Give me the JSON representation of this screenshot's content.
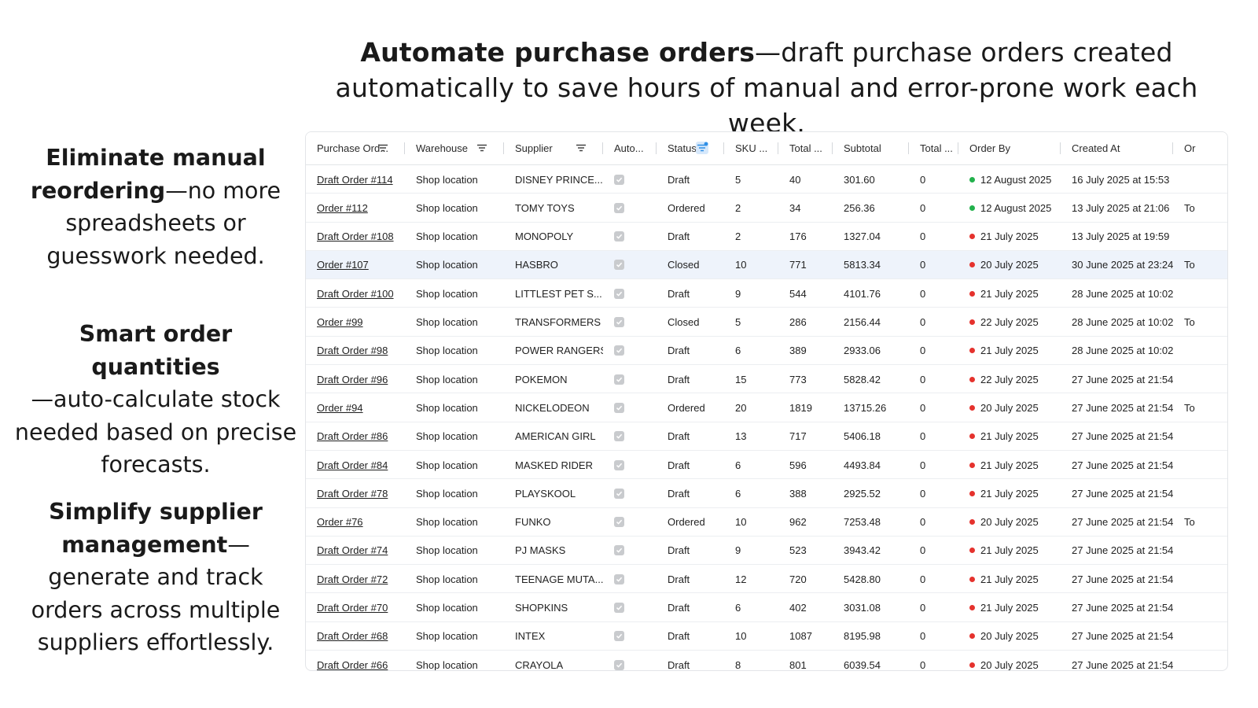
{
  "headline": {
    "bold": "Automate purchase orders",
    "rest": "—draft purchase orders created automatically to save hours of manual and error-prone work each week."
  },
  "features": [
    {
      "bold": "Eliminate manual reordering",
      "rest": "—no more spreadsheets or guesswork needed."
    },
    {
      "bold": "Smart order quantities",
      "rest": "—auto-calculate stock needed based on precise forecasts."
    },
    {
      "bold": "Simplify supplier management",
      "rest": "—generate and track orders across multiple suppliers effortlessly."
    }
  ],
  "table": {
    "columns": [
      {
        "label": "Purchase Ord...",
        "filter": true,
        "active": false
      },
      {
        "label": "Warehouse",
        "filter": true,
        "active": false
      },
      {
        "label": "Supplier",
        "filter": true,
        "active": false
      },
      {
        "label": "Auto...",
        "filter": false,
        "active": false
      },
      {
        "label": "Status",
        "filter": true,
        "active": true
      },
      {
        "label": "SKU ...",
        "filter": false,
        "active": false
      },
      {
        "label": "Total ...",
        "filter": false,
        "active": false
      },
      {
        "label": "Subtotal",
        "filter": false,
        "active": false
      },
      {
        "label": "Total ...",
        "filter": false,
        "active": false
      },
      {
        "label": "Order By",
        "filter": false,
        "active": false
      },
      {
        "label": "Created At",
        "filter": false,
        "active": false
      },
      {
        "label": "Or",
        "filter": false,
        "active": false
      }
    ],
    "status_colors": {
      "green": "#22b14c",
      "red": "#e5322d",
      "highlight_row": "#eef3fb",
      "filter_active_bg": "#d6e8fb",
      "filter_active_dot": "#2f8fe6"
    },
    "rows": [
      {
        "order": "Draft Order #114",
        "warehouse": "Shop location",
        "supplier": "DISNEY PRINCE...",
        "auto": true,
        "status": "Draft",
        "sku": "5",
        "total_qty": "40",
        "subtotal": "301.60",
        "total": "0",
        "order_by": "12 August 2025",
        "dot": "green",
        "created": "16 July 2025 at 15:53",
        "extra": ""
      },
      {
        "order": "Order #112",
        "warehouse": "Shop location",
        "supplier": "TOMY TOYS",
        "auto": true,
        "status": "Ordered",
        "sku": "2",
        "total_qty": "34",
        "subtotal": "256.36",
        "total": "0",
        "order_by": "12 August 2025",
        "dot": "green",
        "created": "13 July 2025 at 21:06",
        "extra": "To"
      },
      {
        "order": "Draft Order #108",
        "warehouse": "Shop location",
        "supplier": "MONOPOLY",
        "auto": true,
        "status": "Draft",
        "sku": "2",
        "total_qty": "176",
        "subtotal": "1327.04",
        "total": "0",
        "order_by": "21 July 2025",
        "dot": "red",
        "created": "13 July 2025 at 19:59",
        "extra": ""
      },
      {
        "order": "Order #107",
        "warehouse": "Shop location",
        "supplier": "HASBRO",
        "auto": true,
        "status": "Closed",
        "sku": "10",
        "total_qty": "771",
        "subtotal": "5813.34",
        "total": "0",
        "order_by": "20 July 2025",
        "dot": "red",
        "created": "30 June 2025 at 23:24",
        "extra": "To",
        "highlight": true
      },
      {
        "order": "Draft Order #100",
        "warehouse": "Shop location",
        "supplier": "LITTLEST PET S...",
        "auto": true,
        "status": "Draft",
        "sku": "9",
        "total_qty": "544",
        "subtotal": "4101.76",
        "total": "0",
        "order_by": "21 July 2025",
        "dot": "red",
        "created": "28 June 2025 at 10:02",
        "extra": ""
      },
      {
        "order": "Order #99",
        "warehouse": "Shop location",
        "supplier": "TRANSFORMERS",
        "auto": true,
        "status": "Closed",
        "sku": "5",
        "total_qty": "286",
        "subtotal": "2156.44",
        "total": "0",
        "order_by": "22 July 2025",
        "dot": "red",
        "created": "28 June 2025 at 10:02",
        "extra": "To"
      },
      {
        "order": "Draft Order #98",
        "warehouse": "Shop location",
        "supplier": "POWER RANGERS",
        "auto": true,
        "status": "Draft",
        "sku": "6",
        "total_qty": "389",
        "subtotal": "2933.06",
        "total": "0",
        "order_by": "21 July 2025",
        "dot": "red",
        "created": "28 June 2025 at 10:02",
        "extra": ""
      },
      {
        "order": "Draft Order #96",
        "warehouse": "Shop location",
        "supplier": "POKEMON",
        "auto": true,
        "status": "Draft",
        "sku": "15",
        "total_qty": "773",
        "subtotal": "5828.42",
        "total": "0",
        "order_by": "22 July 2025",
        "dot": "red",
        "created": "27 June 2025 at 21:54",
        "extra": ""
      },
      {
        "order": "Order #94",
        "warehouse": "Shop location",
        "supplier": "NICKELODEON",
        "auto": true,
        "status": "Ordered",
        "sku": "20",
        "total_qty": "1819",
        "subtotal": "13715.26",
        "total": "0",
        "order_by": "20 July 2025",
        "dot": "red",
        "created": "27 June 2025 at 21:54",
        "extra": "To"
      },
      {
        "order": "Draft Order #86",
        "warehouse": "Shop location",
        "supplier": "AMERICAN GIRL",
        "auto": true,
        "status": "Draft",
        "sku": "13",
        "total_qty": "717",
        "subtotal": "5406.18",
        "total": "0",
        "order_by": "21 July 2025",
        "dot": "red",
        "created": "27 June 2025 at 21:54",
        "extra": ""
      },
      {
        "order": "Draft Order #84",
        "warehouse": "Shop location",
        "supplier": "MASKED RIDER",
        "auto": true,
        "status": "Draft",
        "sku": "6",
        "total_qty": "596",
        "subtotal": "4493.84",
        "total": "0",
        "order_by": "21 July 2025",
        "dot": "red",
        "created": "27 June 2025 at 21:54",
        "extra": ""
      },
      {
        "order": "Draft Order #78",
        "warehouse": "Shop location",
        "supplier": "PLAYSKOOL",
        "auto": true,
        "status": "Draft",
        "sku": "6",
        "total_qty": "388",
        "subtotal": "2925.52",
        "total": "0",
        "order_by": "21 July 2025",
        "dot": "red",
        "created": "27 June 2025 at 21:54",
        "extra": ""
      },
      {
        "order": "Order #76",
        "warehouse": "Shop location",
        "supplier": "FUNKO",
        "auto": true,
        "status": "Ordered",
        "sku": "10",
        "total_qty": "962",
        "subtotal": "7253.48",
        "total": "0",
        "order_by": "20 July 2025",
        "dot": "red",
        "created": "27 June 2025 at 21:54",
        "extra": "To"
      },
      {
        "order": "Draft Order #74",
        "warehouse": "Shop location",
        "supplier": "PJ MASKS",
        "auto": true,
        "status": "Draft",
        "sku": "9",
        "total_qty": "523",
        "subtotal": "3943.42",
        "total": "0",
        "order_by": "21 July 2025",
        "dot": "red",
        "created": "27 June 2025 at 21:54",
        "extra": ""
      },
      {
        "order": "Draft Order #72",
        "warehouse": "Shop location",
        "supplier": "TEENAGE MUTA...",
        "auto": true,
        "status": "Draft",
        "sku": "12",
        "total_qty": "720",
        "subtotal": "5428.80",
        "total": "0",
        "order_by": "21 July 2025",
        "dot": "red",
        "created": "27 June 2025 at 21:54",
        "extra": ""
      },
      {
        "order": "Draft Order #70",
        "warehouse": "Shop location",
        "supplier": "SHOPKINS",
        "auto": true,
        "status": "Draft",
        "sku": "6",
        "total_qty": "402",
        "subtotal": "3031.08",
        "total": "0",
        "order_by": "21 July 2025",
        "dot": "red",
        "created": "27 June 2025 at 21:54",
        "extra": ""
      },
      {
        "order": "Draft Order #68",
        "warehouse": "Shop location",
        "supplier": "INTEX",
        "auto": true,
        "status": "Draft",
        "sku": "10",
        "total_qty": "1087",
        "subtotal": "8195.98",
        "total": "0",
        "order_by": "20 July 2025",
        "dot": "red",
        "created": "27 June 2025 at 21:54",
        "extra": ""
      },
      {
        "order": "Draft Order #66",
        "warehouse": "Shop location",
        "supplier": "CRAYOLA",
        "auto": true,
        "status": "Draft",
        "sku": "8",
        "total_qty": "801",
        "subtotal": "6039.54",
        "total": "0",
        "order_by": "20 July 2025",
        "dot": "red",
        "created": "27 June 2025 at 21:54",
        "extra": ""
      }
    ]
  }
}
